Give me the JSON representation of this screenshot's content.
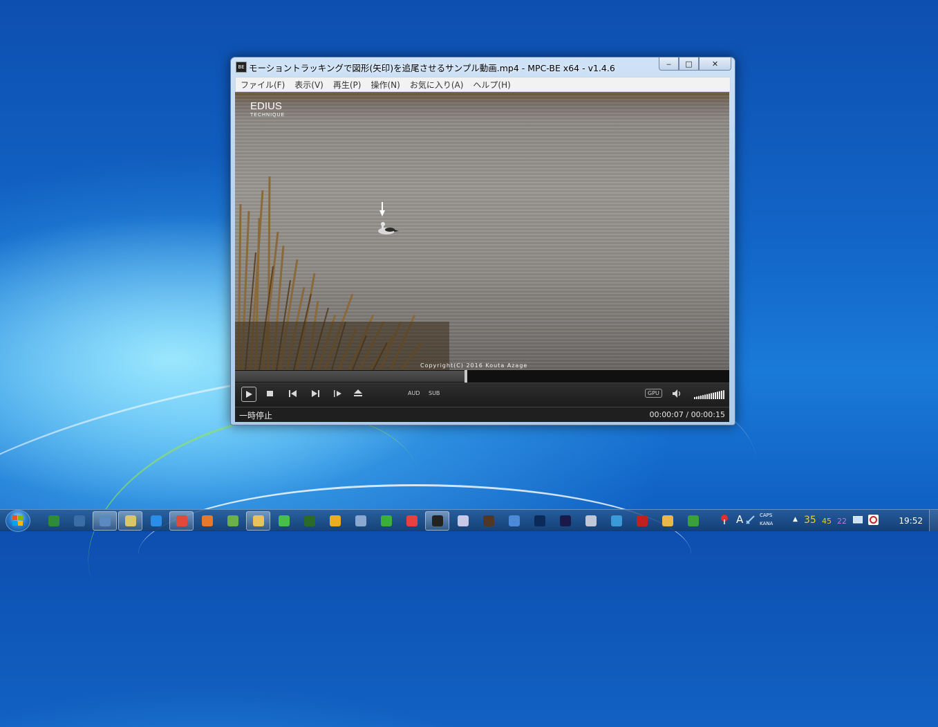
{
  "window": {
    "title": "モーショントラッキングで図形(矢印)を追尾させるサンプル動画.mp4 - MPC-BE x64 - v1.4.6",
    "app_icon_text": "BE",
    "caption": {
      "minimize": "‒",
      "maximize": "□",
      "close": "✕"
    }
  },
  "menu": {
    "items": [
      "ファイル(F)",
      "表示(V)",
      "再生(P)",
      "操作(N)",
      "お気に入り(A)",
      "ヘルプ(H)"
    ]
  },
  "video": {
    "logo_line1": "EDIUS",
    "logo_line2": "TECHNIQUE",
    "copyright": "Copyright(C)  2016 Kouta Azage"
  },
  "playback": {
    "progress_fraction": 0.467,
    "audio_label": "AUD",
    "subtitle_label": "SUB",
    "gpu_label": "GPU",
    "volume_fraction": 1.0
  },
  "status": {
    "state": "一時停止",
    "time": "00:00:07 / 00:00:15"
  },
  "taskbar": {
    "icons": [
      {
        "name": "excel-like-icon",
        "color": "#2e8b3a",
        "active": false
      },
      {
        "name": "monitor-icon",
        "color": "#3a6ea5",
        "active": false
      },
      {
        "name": "system-icon",
        "color": "#5a8ac0",
        "active": true
      },
      {
        "name": "window-icon",
        "color": "#d7c66a",
        "active": true
      },
      {
        "name": "ie-icon",
        "color": "#2a8ee8",
        "active": false
      },
      {
        "name": "chrome-icon",
        "color": "#e04a3a",
        "active": true
      },
      {
        "name": "firefox-icon",
        "color": "#e8782a",
        "active": false
      },
      {
        "name": "editor-icon",
        "color": "#6ab04c",
        "active": false
      },
      {
        "name": "explorer-icon",
        "color": "#e8c25a",
        "active": true
      },
      {
        "name": "play-green-icon",
        "color": "#46c048",
        "active": false
      },
      {
        "name": "play-dark-icon",
        "color": "#2a6a2a",
        "active": false
      },
      {
        "name": "vlc-like-icon",
        "color": "#e8b020",
        "active": false
      },
      {
        "name": "notes-icon",
        "color": "#8aa8d0",
        "active": false
      },
      {
        "name": "s-icon",
        "color": "#3ab03a",
        "active": false
      },
      {
        "name": "alarm-icon",
        "color": "#e84040",
        "active": false
      },
      {
        "name": "mpc-be-icon",
        "color": "#222222",
        "active": true
      },
      {
        "name": "itunes-icon",
        "color": "#c8c8e8",
        "active": false
      },
      {
        "name": "obs-icon",
        "color": "#503828",
        "active": false
      },
      {
        "name": "globe-icon",
        "color": "#4a8ad8",
        "active": false
      },
      {
        "name": "photoshop-icon",
        "color": "#0a2a5a",
        "active": false
      },
      {
        "name": "after-effects-icon",
        "color": "#1a1a4a",
        "active": false
      },
      {
        "name": "calculator-icon",
        "color": "#c0c8d8",
        "active": false
      },
      {
        "name": "image-viewer-icon",
        "color": "#3a9ad8",
        "active": false
      },
      {
        "name": "ladybug-icon",
        "color": "#c02020",
        "active": false
      },
      {
        "name": "paint-icon",
        "color": "#e8b84a",
        "active": false
      },
      {
        "name": "magnifier-icon",
        "color": "#3aa03a",
        "active": false
      }
    ],
    "tray": {
      "ime_label": "A",
      "caps": "CAPS",
      "kana": "KANA",
      "num1": "35",
      "num2": "45",
      "num3": "22",
      "clock": "19:52",
      "num1_color": "#f0d020",
      "num2_color": "#f0d020",
      "num3_color": "#b080e0"
    }
  }
}
